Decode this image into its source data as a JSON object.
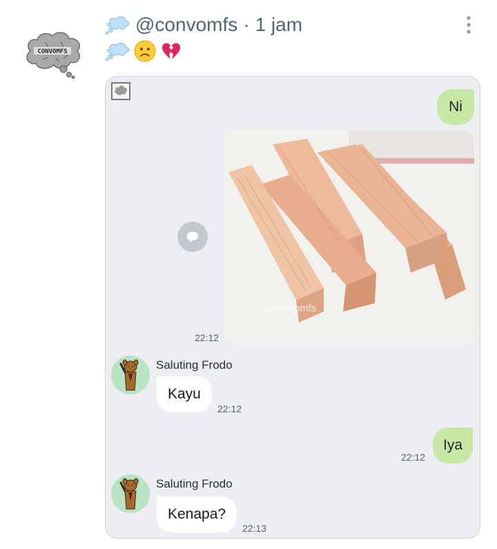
{
  "tweet": {
    "handle": "@convomfs",
    "separator": "·",
    "time_ago": "1 jam",
    "avatar_text": "CONVOMFS",
    "emojis": [
      "thought-bubble-icon",
      "frowning-face-icon",
      "broken-heart-icon"
    ]
  },
  "chat": {
    "messages": [
      {
        "side": "out",
        "text": "Ni"
      },
      {
        "side": "out",
        "type": "image",
        "watermark": "@convomfs",
        "time": "22:12"
      },
      {
        "side": "in",
        "sender": "Saluting Frodo",
        "text": "Kayu",
        "time": "22:12"
      },
      {
        "side": "out",
        "text": "Iya",
        "time": "22:12"
      },
      {
        "side": "in",
        "sender": "Saluting Frodo",
        "text": "Kenapa?",
        "time": "22:13"
      }
    ]
  },
  "colors": {
    "outgoing_bubble": "#c8e6a6",
    "incoming_bubble": "#ffffff",
    "chat_background": "#eceef2",
    "handle_text": "#536471"
  }
}
